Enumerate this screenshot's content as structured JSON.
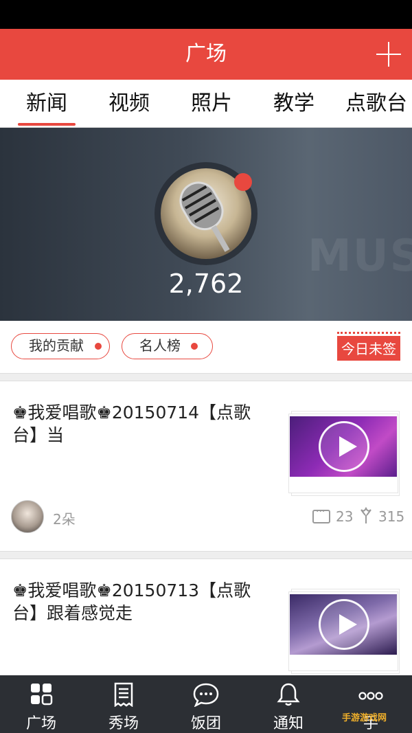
{
  "header": {
    "title": "广场",
    "add_icon": "plus-icon"
  },
  "tabs": [
    {
      "label": "新闻",
      "active": true
    },
    {
      "label": "视频",
      "active": false
    },
    {
      "label": "照片",
      "active": false
    },
    {
      "label": "教学",
      "active": false
    },
    {
      "label": "点歌台",
      "active": false
    }
  ],
  "banner": {
    "count": "2,762",
    "badge_color": "#e8483f"
  },
  "actions": {
    "contribution_label": "我的贡献",
    "celebrity_label": "名人榜",
    "sign_label": "今日未签"
  },
  "posts": [
    {
      "title": "♚我爱唱歌♚20150714【点歌台】当",
      "flowers": "2朵",
      "comments": "23",
      "likes": "315"
    },
    {
      "title": "♚我爱唱歌♚20150713【点歌台】跟着感觉走"
    }
  ],
  "bottom_nav": [
    {
      "label": "广场",
      "icon": "grid-icon"
    },
    {
      "label": "秀场",
      "icon": "document-icon"
    },
    {
      "label": "饭团",
      "icon": "chat-bubble-icon"
    },
    {
      "label": "通知",
      "icon": "bell-icon"
    },
    {
      "label": "手",
      "icon": "more-icon"
    }
  ],
  "watermark": "手游游戏网",
  "colors": {
    "accent": "#e8483f",
    "nav_bg": "#2c2f34"
  }
}
